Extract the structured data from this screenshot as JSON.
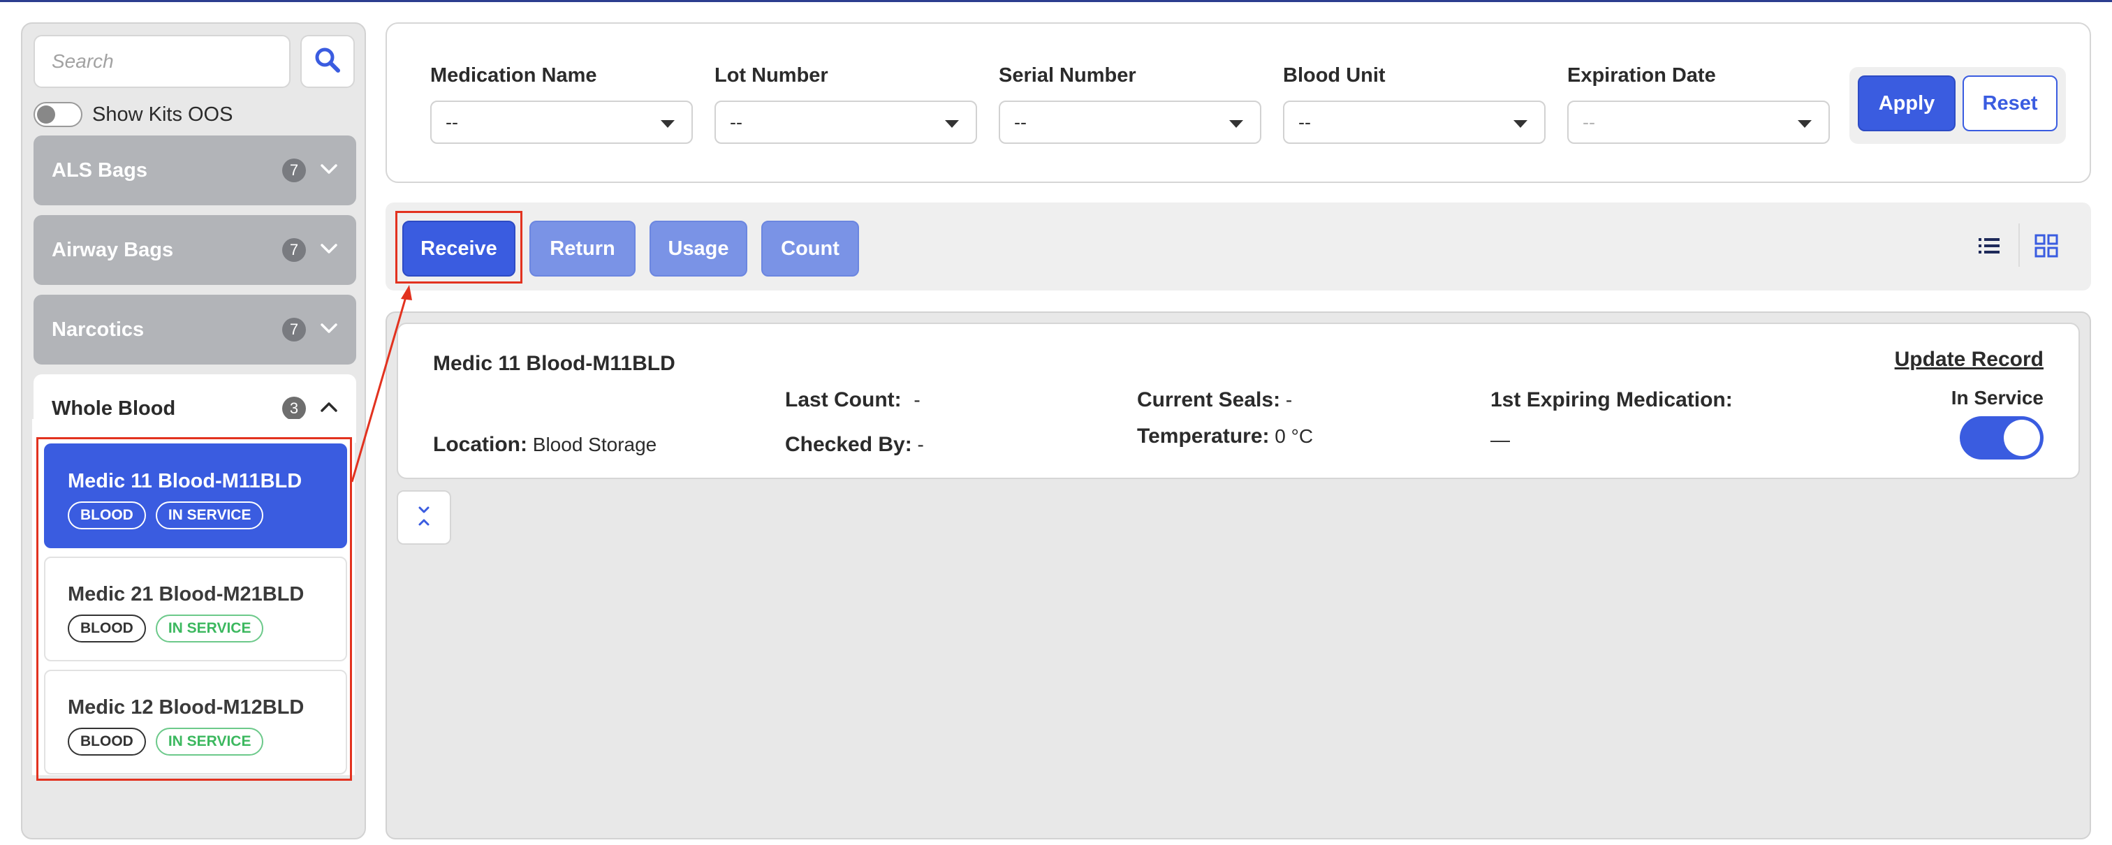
{
  "sidebar": {
    "search": {
      "placeholder": "Search"
    },
    "show_oos_label": "Show Kits OOS",
    "groups": [
      {
        "label": "ALS Bags",
        "count": "7"
      },
      {
        "label": "Airway Bags",
        "count": "7"
      },
      {
        "label": "Narcotics",
        "count": "7"
      },
      {
        "label": "Whole Blood",
        "count": "3"
      }
    ],
    "kits": [
      {
        "title": "Medic 11 Blood-M11BLD",
        "type": "BLOOD",
        "status": "IN SERVICE"
      },
      {
        "title": "Medic 21 Blood-M21BLD",
        "type": "BLOOD",
        "status": "IN SERVICE"
      },
      {
        "title": "Medic 12 Blood-M12BLD",
        "type": "BLOOD",
        "status": "IN SERVICE"
      }
    ]
  },
  "filters": {
    "fields": [
      {
        "label": "Medication Name",
        "value": "--"
      },
      {
        "label": "Lot Number",
        "value": "--"
      },
      {
        "label": "Serial Number",
        "value": "--"
      },
      {
        "label": "Blood Unit",
        "value": "--"
      },
      {
        "label": "Expiration Date",
        "value": "--"
      }
    ],
    "apply_label": "Apply",
    "reset_label": "Reset"
  },
  "actions": {
    "receive_label": "Receive",
    "return_label": "Return",
    "usage_label": "Usage",
    "count_label": "Count"
  },
  "record": {
    "title": "Medic 11 Blood-M11BLD",
    "update_label": "Update Record",
    "location_label": "Location:",
    "location_value": "Blood Storage",
    "last_count_label": "Last Count:",
    "last_count_value": "-",
    "checked_by_label": "Checked By:",
    "checked_by_value": "-",
    "current_seals_label": "Current Seals:",
    "current_seals_value": "-",
    "temperature_label": "Temperature:",
    "temperature_value": "0 °C",
    "first_expiring_label": "1st Expiring Medication:",
    "first_expiring_value": "—",
    "in_service_label": "In Service"
  },
  "colors": {
    "primary": "#3a5ce0",
    "secondary_button": "#7a93e6",
    "annotation": "#e2321f",
    "in_service_green": "#3cb85f"
  }
}
